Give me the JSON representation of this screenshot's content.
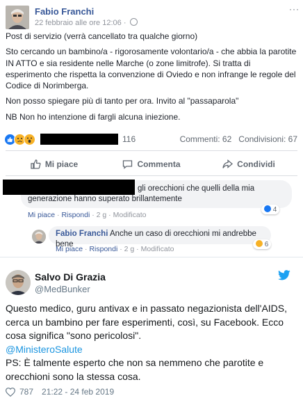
{
  "fb_post": {
    "author": "Fabio Franchi",
    "date": "22 febbraio alle ore 12:06 ·",
    "menu": "···",
    "paragraphs": [
      "Post di servizio (verrà cancellato tra qualche giorno)",
      "Sto cercando un bambino/a - rigorosamente volontario/a - che abbia la parotite IN ATTO e sia residente nelle Marche (o zone limitrofe). Si tratta di esperimento che rispetta la convenzione di Oviedo e non infrange le regole del Codice di Norimberga.",
      "Non posso spiegare più di tanto per ora. Invito al \"passaparola\"",
      "NB Non ho intenzione di fargli alcuna iniezione."
    ],
    "reactions_count": "116",
    "comments_count": "Commenti: 62",
    "shares_count": "Condivisioni: 67",
    "actions": {
      "like": "Mi piace",
      "comment": "Commenta",
      "share": "Condividi"
    }
  },
  "comments": [
    {
      "text": "gli orecchioni che quelli della mia generazione hanno superato brillantemente",
      "meta_like": "Mi piace",
      "meta_reply": "Rispondi",
      "meta_time": "2 g",
      "meta_edited": "Modificato",
      "reaction_count": "4"
    },
    {
      "author": "Fabio Franchi",
      "text": "Anche un caso di orecchioni mi andrebbe bene",
      "meta_like": "Mi piace",
      "meta_reply": "Rispondi",
      "meta_time": "2 g",
      "meta_edited": "Modificato",
      "reaction_count": "6"
    }
  ],
  "tweet": {
    "name": "Salvo Di Grazia",
    "handle": "@MedBunker",
    "text_1": "Questo medico, guru antivax e in passato negazionista dell'AIDS, cerca un bambino per fare esperimenti, così, su Facebook. Ecco cosa significa \"sono pericolosi\".",
    "mention": "@MinisteroSalute",
    "text_2": "PS: È talmente esperto che non sa nemmeno che parotite e orecchioni sono la stessa cosa.",
    "likes": "787",
    "timestamp": "21:22 - 24 feb 2019"
  },
  "colors": {
    "fb_link": "#385898",
    "fb_like": "#1877f2",
    "twitter_blue": "#1da1f2"
  }
}
